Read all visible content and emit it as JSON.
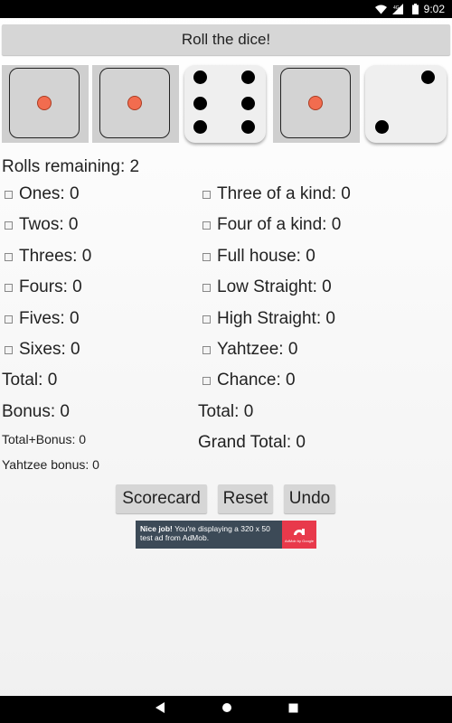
{
  "status_bar": {
    "time": "9:02",
    "network": "4G"
  },
  "roll_button": "Roll the dice!",
  "rolls_remaining": "Rolls remaining: 2",
  "dice": [
    {
      "value": 1,
      "held": true
    },
    {
      "value": 1,
      "held": true
    },
    {
      "value": 6,
      "held": false
    },
    {
      "value": 1,
      "held": true
    },
    {
      "value": 2,
      "held": false
    }
  ],
  "upper": {
    "ones": "Ones: 0",
    "twos": "Twos: 0",
    "threes": "Threes: 0",
    "fours": "Fours: 0",
    "fives": "Fives: 0",
    "sixes": "Sixes: 0",
    "total": "Total: 0",
    "bonus": "Bonus: 0",
    "total_bonus": "Total+Bonus: 0",
    "yahtzee_bonus": "Yahtzee bonus: 0"
  },
  "lower": {
    "three_kind": "Three of a kind: 0",
    "four_kind": "Four of a kind: 0",
    "full_house": "Full house: 0",
    "low_straight": "Low Straight: 0",
    "high_straight": "High Straight: 0",
    "yahtzee": "Yahtzee: 0",
    "chance": "Chance: 0",
    "total": "Total: 0",
    "grand_total": "Grand Total: 0"
  },
  "buttons": {
    "scorecard": "Scorecard",
    "reset": "Reset",
    "undo": "Undo"
  },
  "ad": {
    "bold": "Nice job!",
    "text": " You're displaying a 320 x 50 test ad from AdMob.",
    "logo": "AdMob by Google"
  },
  "colors": {
    "held_pip": "#f26c4f",
    "pip": "#000000",
    "ad_bg": "#3c4a57",
    "ad_logo_bg": "#e8394b"
  },
  "icons": [
    "wifi-icon",
    "signal-icon",
    "battery-icon",
    "back-icon",
    "home-icon",
    "recents-icon"
  ]
}
